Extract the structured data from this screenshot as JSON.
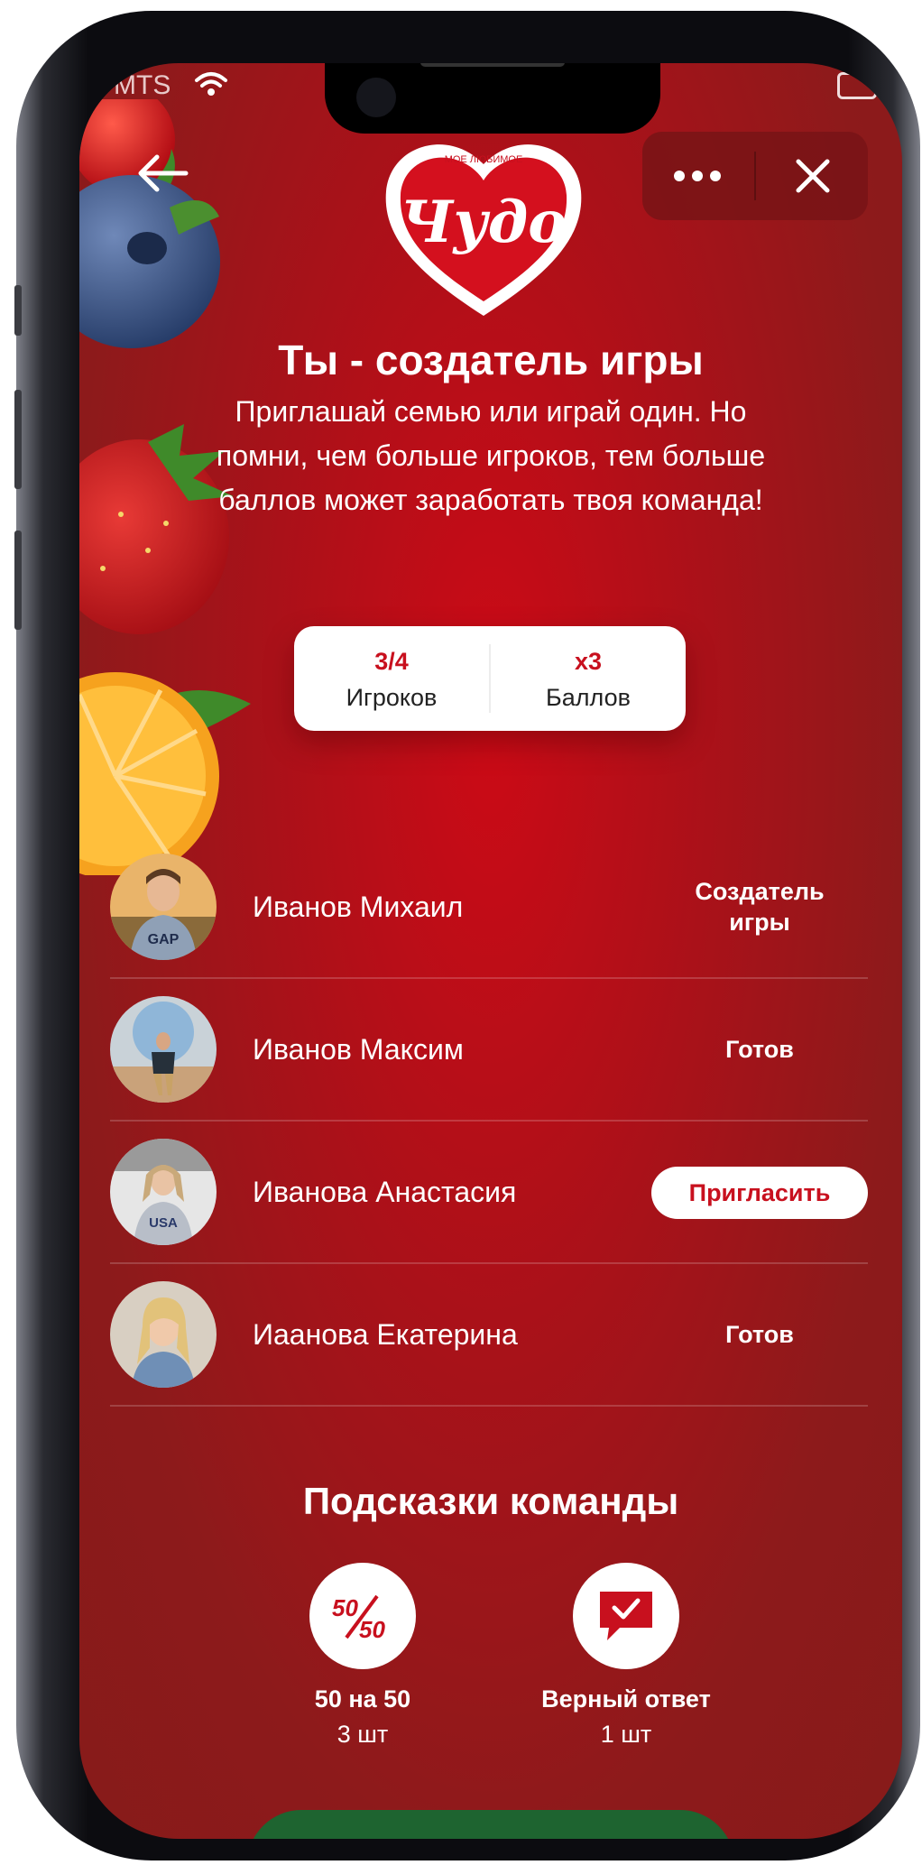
{
  "status_bar": {
    "carrier": "MTS"
  },
  "header": {
    "more_label": "•••"
  },
  "logo": {
    "tagline": "МОЕ ЛЮБИМОЕ",
    "brand": "Чудо"
  },
  "title": "Ты - создатель игры",
  "subtitle": "Приглашай семью или играй один. Но помни, чем больше игроков, тем больше баллов может заработать твоя команда!",
  "stats": {
    "players_value": "3/4",
    "players_label": "Игроков",
    "points_value": "x3",
    "points_label": "Баллов"
  },
  "players": [
    {
      "name": "Иванов Михаил",
      "status": "Создатель игры"
    },
    {
      "name": "Иванов Максим",
      "status": "Готов"
    },
    {
      "name": "Иванова Анастасия",
      "status": "Пригласить"
    },
    {
      "name": "Иаанова Екатерина",
      "status": "Готов"
    }
  ],
  "hints": {
    "title": "Подсказки команды",
    "items": [
      {
        "icon_text": "50/50",
        "name": "50 на 50",
        "count": "3 шт",
        "icon": "fifty-fifty-icon"
      },
      {
        "name": "Верный ответ",
        "count": "1 шт",
        "icon": "check-message-icon"
      }
    ]
  },
  "colors": {
    "background": "#aa1119",
    "accent": "#c8101e",
    "bottom_button": "#1e6430"
  }
}
